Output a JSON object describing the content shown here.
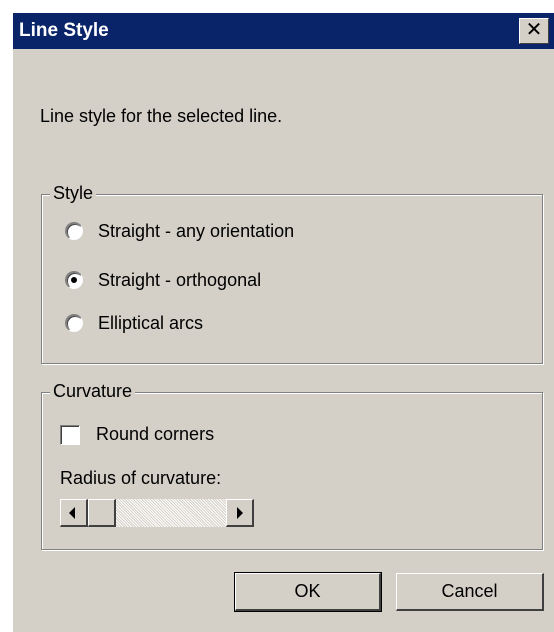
{
  "dialog": {
    "title": "Line Style",
    "close_glyph": "✕",
    "instruction": "Line style for the selected line."
  },
  "style_group": {
    "legend": "Style",
    "options": [
      {
        "label": "Straight - any orientation",
        "checked": false
      },
      {
        "label": "Straight - orthogonal",
        "checked": true
      },
      {
        "label": "Elliptical arcs",
        "checked": false
      }
    ]
  },
  "curvature_group": {
    "legend": "Curvature",
    "round_corners_label": "Round corners",
    "round_corners_checked": false,
    "radius_label": "Radius of curvature:",
    "radius_slider_position": 0
  },
  "buttons": {
    "ok": "OK",
    "cancel": "Cancel"
  },
  "colors": {
    "titlebar": "#0a246a",
    "face": "#d4d0c8"
  }
}
